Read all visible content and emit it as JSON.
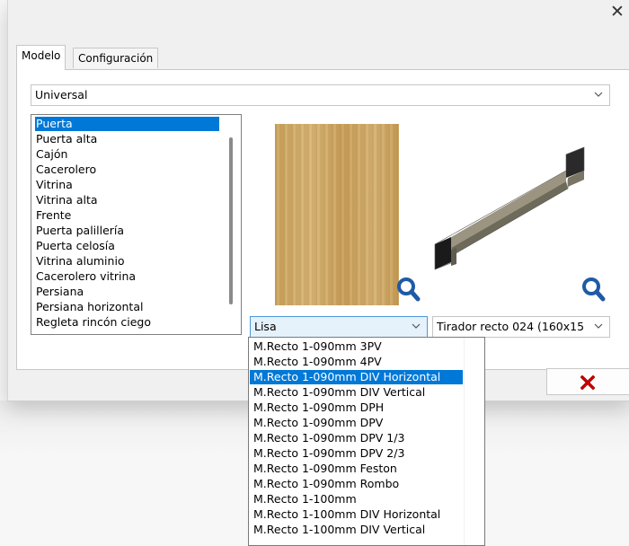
{
  "window": {
    "close_glyph": "✕"
  },
  "tabs": [
    {
      "label": "Modelo",
      "active": true
    },
    {
      "label": "Configuración",
      "active": false
    }
  ],
  "category_combo": {
    "value": "Universal"
  },
  "door_list": {
    "selected_index": 0,
    "items": [
      "Puerta",
      "Puerta alta",
      "Cajón",
      "Cacerolero",
      "Vitrina",
      "Vitrina alta",
      "Frente",
      "Puerta palillería",
      "Puerta celosía",
      "Vitrina aluminio",
      "Cacerolero vitrina",
      "Persiana",
      "Persiana horizontal",
      "Regleta rincón ciego"
    ]
  },
  "model_combo": {
    "value": "Lisa"
  },
  "handle_combo": {
    "value": "Tirador recto 024 (160x15"
  },
  "model_dropdown": {
    "selected_index": 2,
    "items": [
      "M.Recto 1-090mm 3PV",
      "M.Recto 1-090mm 4PV",
      "M.Recto 1-090mm DIV Horizontal",
      "M.Recto 1-090mm DIV Vertical",
      "M.Recto 1-090mm DPH",
      "M.Recto 1-090mm DPV",
      "M.Recto 1-090mm DPV 1/3",
      "M.Recto 1-090mm DPV 2/3",
      "M.Recto 1-090mm Feston",
      "M.Recto 1-090mm Rombo",
      "M.Recto 1-100mm",
      "M.Recto 1-100mm DIV Horizontal",
      "M.Recto 1-100mm DIV Vertical"
    ]
  },
  "colors": {
    "accent": "#0078d7",
    "cancel_red": "#c00000",
    "zoom_blue": "#1f5aa6"
  }
}
